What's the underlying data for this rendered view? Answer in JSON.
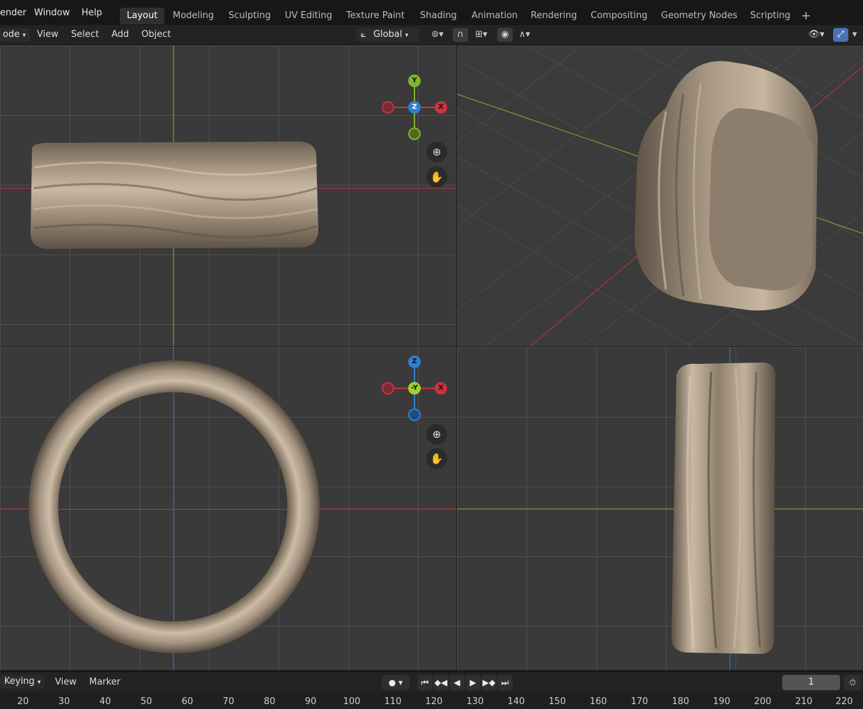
{
  "menu": {
    "items": [
      "ender",
      "Window",
      "Help"
    ]
  },
  "workspaces": {
    "active": "Layout",
    "tabs": [
      "Layout",
      "Modeling",
      "Sculpting",
      "UV Editing",
      "Texture Paint",
      "Shading",
      "Animation",
      "Rendering",
      "Compositing",
      "Geometry Nodes",
      "Scripting"
    ],
    "add_label": "+"
  },
  "header": {
    "mode_label": "ode",
    "view": "View",
    "select": "Select",
    "add": "Add",
    "object": "Object",
    "transform_orientation": "Global"
  },
  "gizmos": {
    "top_view": {
      "up": "Y",
      "center": "Z",
      "right": "X"
    },
    "front_view": {
      "up": "Z",
      "center": "-Y",
      "right": "X"
    }
  },
  "timeline": {
    "keying": "Keying",
    "view": "View",
    "marker": "Marker",
    "current_frame": "1",
    "ruler": [
      "20",
      "30",
      "40",
      "50",
      "60",
      "70",
      "80",
      "90",
      "100",
      "110",
      "120",
      "130",
      "140",
      "150",
      "160",
      "170",
      "180",
      "190",
      "200",
      "210",
      "220"
    ]
  },
  "colors": {
    "x_axis": "#c8333d",
    "y_axis": "#7fb52a",
    "z_axis": "#2f7fd6",
    "ring_metal": "#a1907c"
  }
}
